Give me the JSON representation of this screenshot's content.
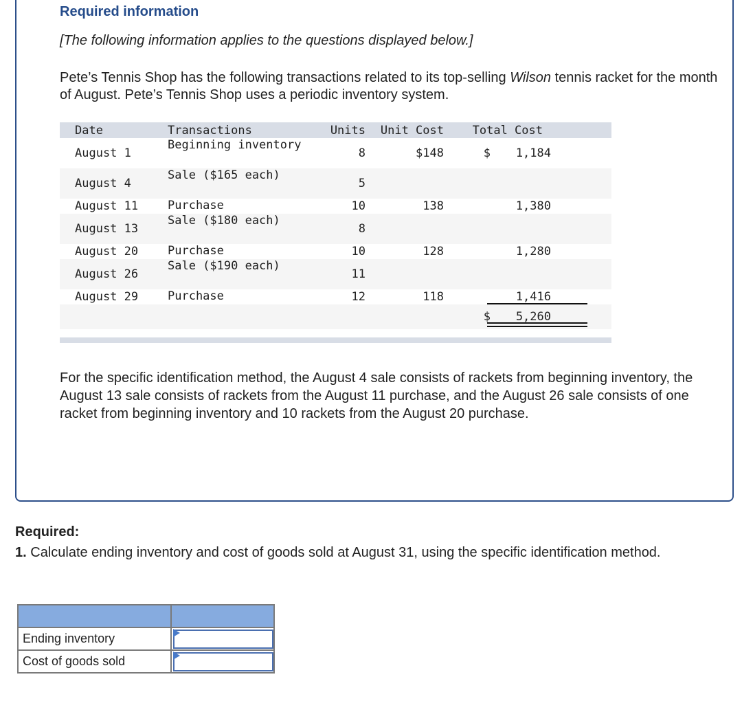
{
  "header": {
    "title": "Required information",
    "bracket_note": "[The following information applies to the questions displayed below.]"
  },
  "intro": {
    "before_italic": "Pete’s Tennis Shop has the following transactions related to its top-selling ",
    "italic": "Wilson",
    "after_italic": " tennis racket for the month of August. Pete’s Tennis Shop uses a periodic inventory system."
  },
  "table": {
    "headers": [
      "Date",
      "Transactions",
      "Units",
      "Unit Cost",
      "Total Cost"
    ],
    "rows": [
      {
        "date": "August  1",
        "transaction": "Beginning inventory",
        "units": "8",
        "unit_cost": "$148",
        "dollar": "$",
        "total_cost": "1,184"
      },
      {
        "date": "August  4",
        "transaction": "Sale ($165 each)",
        "units": "5",
        "unit_cost": "",
        "dollar": "",
        "total_cost": ""
      },
      {
        "date": "August 11",
        "transaction": "Purchase",
        "units": "10",
        "unit_cost": "138",
        "dollar": "",
        "total_cost": "1,380"
      },
      {
        "date": "August 13",
        "transaction": "Sale ($180 each)",
        "units": "8",
        "unit_cost": "",
        "dollar": "",
        "total_cost": ""
      },
      {
        "date": "August 20",
        "transaction": "Purchase",
        "units": "10",
        "unit_cost": "128",
        "dollar": "",
        "total_cost": "1,280"
      },
      {
        "date": "August 26",
        "transaction": "Sale ($190 each)",
        "units": "11",
        "unit_cost": "",
        "dollar": "",
        "total_cost": ""
      },
      {
        "date": "August 29",
        "transaction": "Purchase",
        "units": "12",
        "unit_cost": "118",
        "dollar": "",
        "total_cost": "1,416"
      }
    ],
    "total": {
      "dollar": "$",
      "value": "5,260"
    }
  },
  "note": "For the specific identification method, the August 4 sale consists of rackets from beginning inventory, the August 13 sale consists of rackets from the August 11 purchase, and the August 26 sale consists of one racket from beginning inventory and 10 rackets from the August 20 purchase.",
  "required": {
    "label": "Required:",
    "number": "1.",
    "text": " Calculate ending inventory and cost of goods sold at August 31, using the specific identification method."
  },
  "answer_table": {
    "rows": [
      {
        "label": "Ending inventory",
        "value": ""
      },
      {
        "label": "Cost of goods sold",
        "value": ""
      }
    ]
  }
}
